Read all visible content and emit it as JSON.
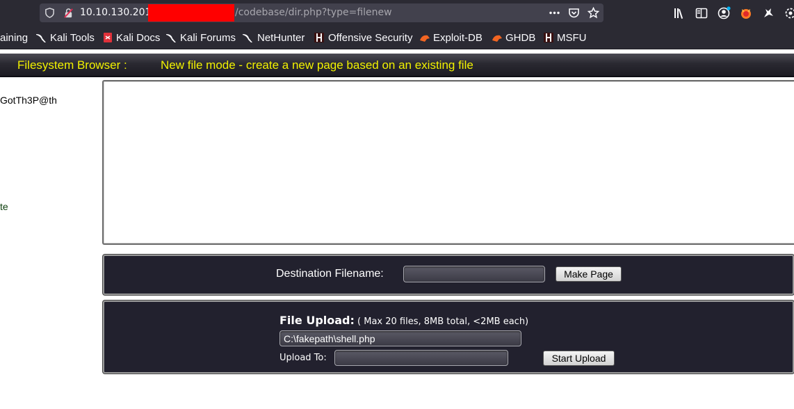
{
  "browser": {
    "url_host": "10.10.130.201",
    "url_path": "/codebase/dir.php?type=filenew",
    "bookmarks": [
      {
        "label": "aining",
        "icon": "none"
      },
      {
        "label": "Kali Tools",
        "icon": "kali-dragon-icon"
      },
      {
        "label": "Kali Docs",
        "icon": "kali-docs-icon"
      },
      {
        "label": "Kali Forums",
        "icon": "kali-dragon-icon"
      },
      {
        "label": "NetHunter",
        "icon": "kali-dragon-icon"
      },
      {
        "label": "Offensive Security",
        "icon": "offsec-icon"
      },
      {
        "label": "Exploit-DB",
        "icon": "exploit-db-icon"
      },
      {
        "label": "GHDB",
        "icon": "exploit-db-icon"
      },
      {
        "label": "MSFU",
        "icon": "offsec-icon"
      }
    ]
  },
  "page": {
    "title_left": "Filesystem Browser :",
    "title_mode": "New file mode - create a new page based on an existing file",
    "left_text_1": "GotTh3P@th",
    "left_text_2": "te",
    "content_value": "",
    "destination": {
      "label": "Destination Filename:",
      "value": "",
      "button": "Make Page"
    },
    "upload": {
      "heading": "File Upload:",
      "note": " ( Max 20 files, 8MB total, <2MB each)",
      "file_value": "C:\\fakepath\\shell.php",
      "upload_to_label": "Upload To:",
      "upload_to_value": "",
      "button": "Start Upload"
    }
  },
  "colors": {
    "chrome_bg": "#2b2a33",
    "urlbox_bg": "#42414d",
    "title_text": "#f2f200",
    "panel_bg": "#22212e",
    "redaction": "#ff0000"
  }
}
